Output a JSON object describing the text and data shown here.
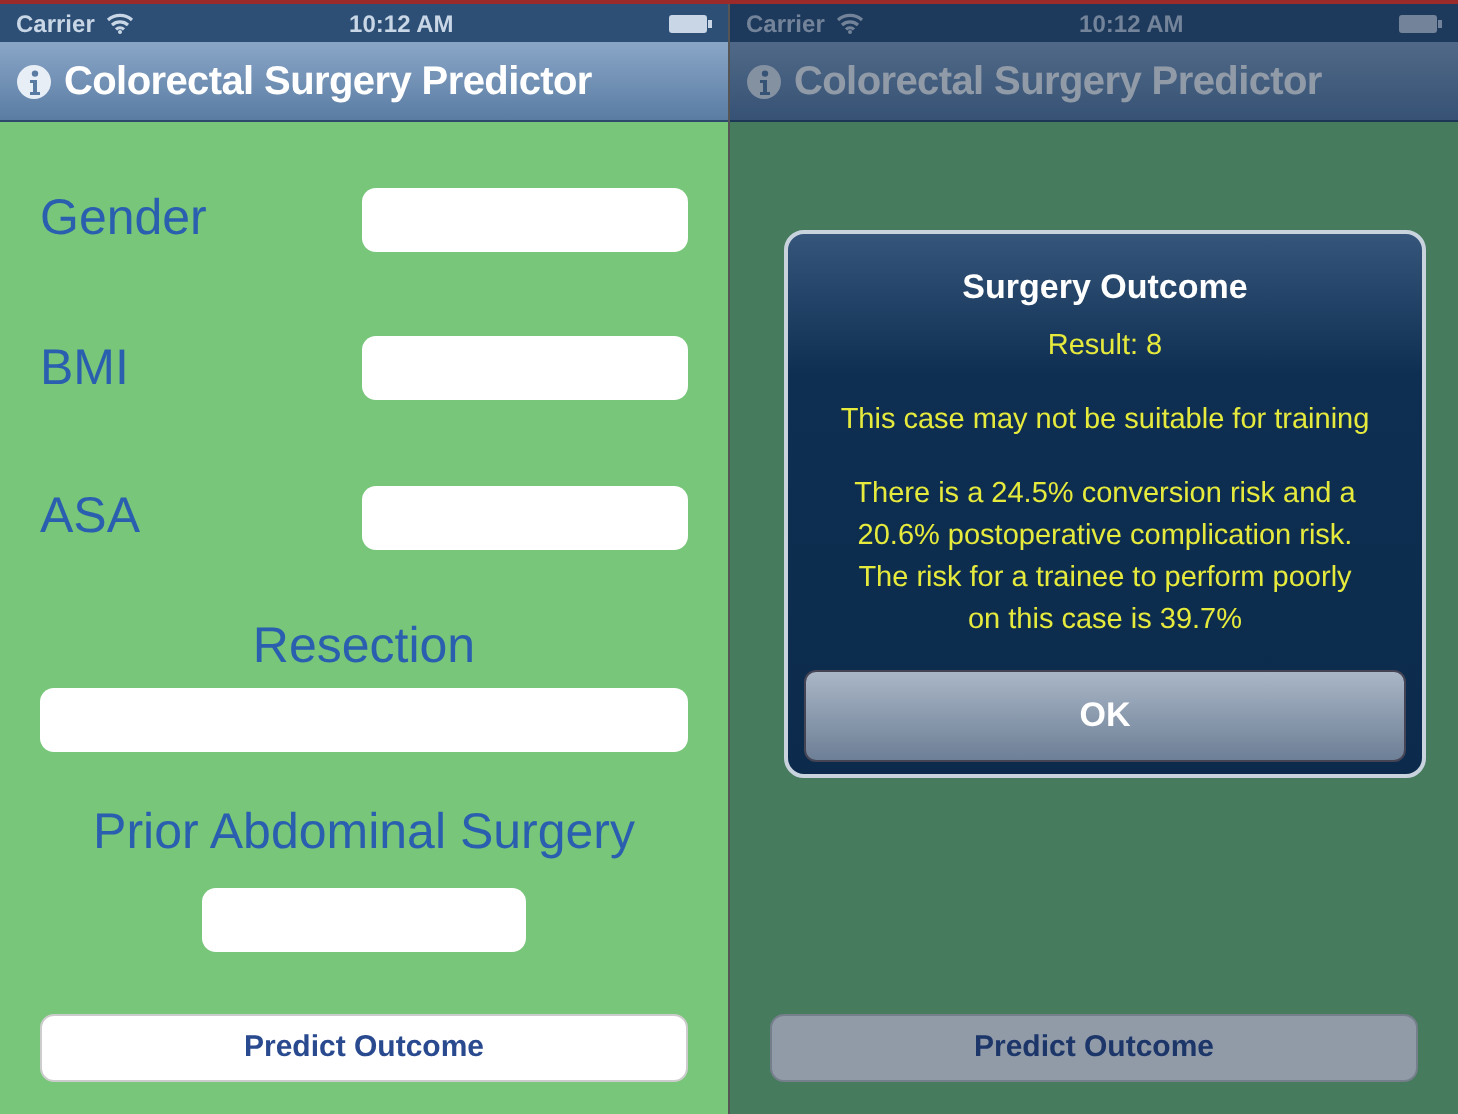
{
  "screens": [
    {
      "status_bar": {
        "carrier": "Carrier",
        "time": "10:12 AM"
      },
      "nav_title": "Colorectal Surgery Predictor",
      "dimmed": false,
      "form": [
        {
          "kind": "inline",
          "label": "Gender"
        },
        {
          "kind": "inline",
          "label": "BMI"
        },
        {
          "kind": "inline",
          "label": "ASA"
        },
        {
          "kind": "wide",
          "label": "Resection"
        },
        {
          "kind": "narrow",
          "label": "Prior Abdominal Surgery"
        }
      ],
      "button": "Predict Outcome"
    },
    {
      "status_bar": {
        "carrier": "Carrier",
        "time": "10:12 AM"
      },
      "nav_title": "Colorectal Surgery Predictor",
      "dimmed": true,
      "button": "Predict Outcome",
      "alert": {
        "title": "Surgery Outcome",
        "result": "Result: 8",
        "messages": [
          "This case may not be suitable for training",
          "There is a 24.5% conversion risk and a 20.6% postoperative complication risk. The risk for a trainee to perform poorly on this case is 39.7%"
        ],
        "button": "OK"
      }
    }
  ]
}
